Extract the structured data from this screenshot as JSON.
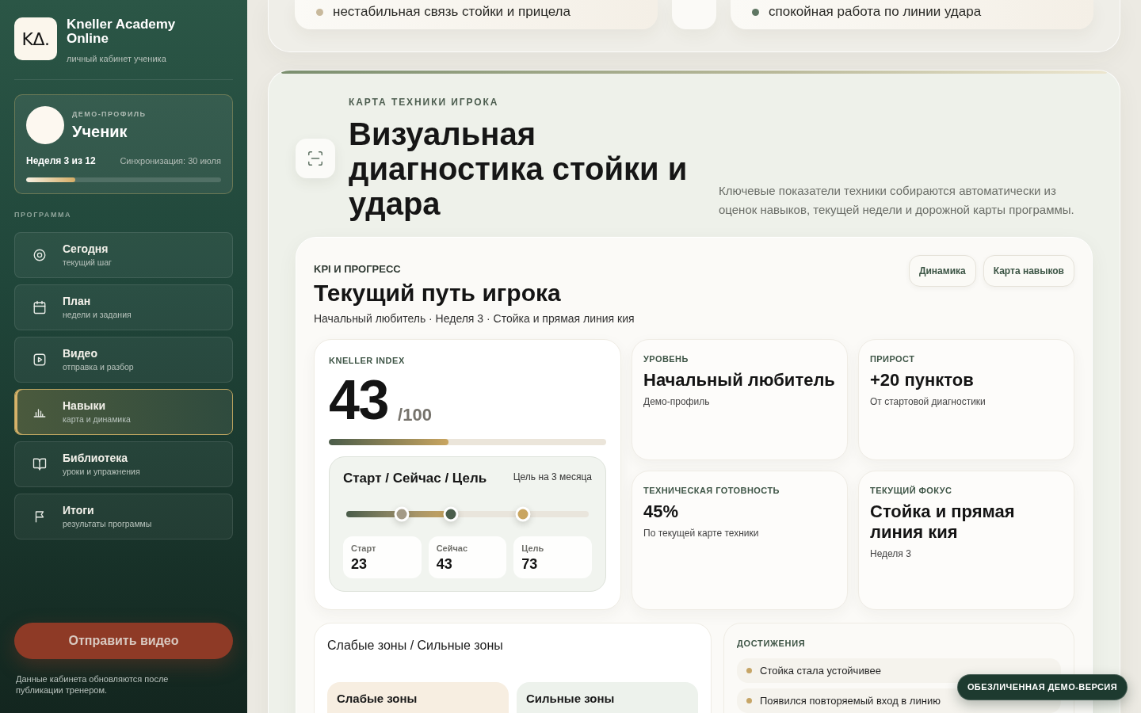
{
  "sidebar": {
    "brand": {
      "logo": "KΔ.",
      "name": "Kneller Academy Online",
      "tagline": "личный кабинет ученика"
    },
    "profile": {
      "eyebrow": "ДЕМО-ПРОФИЛЬ",
      "name": "Ученик",
      "week": "Неделя 3 из 12",
      "sync": "Синхронизация: 30 июля",
      "level": 0.25
    },
    "section_label": "ПРОГРАММА",
    "nav": [
      {
        "title": "Сегодня",
        "subtitle": "текущий шаг",
        "selected": false
      },
      {
        "title": "План",
        "subtitle": "недели и задания",
        "selected": false
      },
      {
        "title": "Видео",
        "subtitle": "отправка и разбор",
        "selected": false
      },
      {
        "title": "Навыки",
        "subtitle": "карта и динамика",
        "selected": true
      },
      {
        "title": "Библиотека",
        "subtitle": "уроки и упражнения",
        "selected": false
      },
      {
        "title": "Итоги",
        "subtitle": "результаты программы",
        "selected": false
      }
    ],
    "action_button": "Отправить видео",
    "footer_note": "Данные кабинета обновляются после публикации тренером."
  },
  "top_cards": [
    {
      "text": "нестабильная связь стойки и прицела",
      "color": "#c8b99c"
    },
    {
      "text": "спокойная работа по линии удара",
      "color": "#5f7763"
    }
  ],
  "technique": {
    "eyebrow": "КАРТА ТЕХНИКИ ИГРОКА",
    "title": "Визуальная диагностика стойки и удара",
    "description": "Ключевые показатели техники собираются автоматически из оценок навыков, текущей недели и дорожной карты программы."
  },
  "kpi": {
    "eyebrow": "KPI И ПРОГРЕСС",
    "title": "Текущий путь игрока",
    "subtitle": "Начальный любитель · Неделя 3 · Стойка и прямая линия кия",
    "buttons": [
      "Динамика",
      "Карта навыков"
    ],
    "index": {
      "label": "KNELLER INDEX",
      "value": "43",
      "max": "/100",
      "level": 0.43
    },
    "journey": {
      "title": "Старт / Сейчас / Цель",
      "note": "Цель на 3 месяца",
      "level": 0.43,
      "markers": [
        {
          "label": "Старт",
          "value": "23",
          "level": 0.23,
          "color": "#a39a86"
        },
        {
          "label": "Сейчас",
          "value": "43",
          "level": 0.43,
          "color": "#4b5e4c"
        },
        {
          "label": "Цель",
          "value": "73",
          "level": 0.73,
          "color": "#c9a560"
        }
      ]
    },
    "metrics": [
      {
        "label": "УРОВЕНЬ",
        "value": "Начальный любитель",
        "note": "Демо-профиль"
      },
      {
        "label": "ПРИРОСТ",
        "value": "+20 пунктов",
        "note": "От стартовой диагностики"
      },
      {
        "label": "ТЕХНИЧЕСКАЯ ГОТОВНОСТЬ",
        "value": "45%",
        "note": "По текущей карте техники"
      },
      {
        "label": "ТЕКУЩИЙ ФОКУС",
        "value": "Стойка и прямая линия кия",
        "note": "Неделя 3"
      }
    ]
  },
  "zones": {
    "title": "Слабые зоны / Сильные зоны",
    "columns": [
      {
        "label": "Слабые зоны",
        "color": "#f7eee1"
      },
      {
        "label": "Сильные зоны",
        "color": "#edf2ec"
      }
    ]
  },
  "achievements": {
    "label": "ДОСТИЖЕНИЯ",
    "items": [
      "Стойка стала устойчивее",
      "Появился повторяемый вход в линию"
    ]
  },
  "demo_badge": "ОБЕЗЛИЧЕННАЯ ДЕМО-ВЕРСИЯ"
}
